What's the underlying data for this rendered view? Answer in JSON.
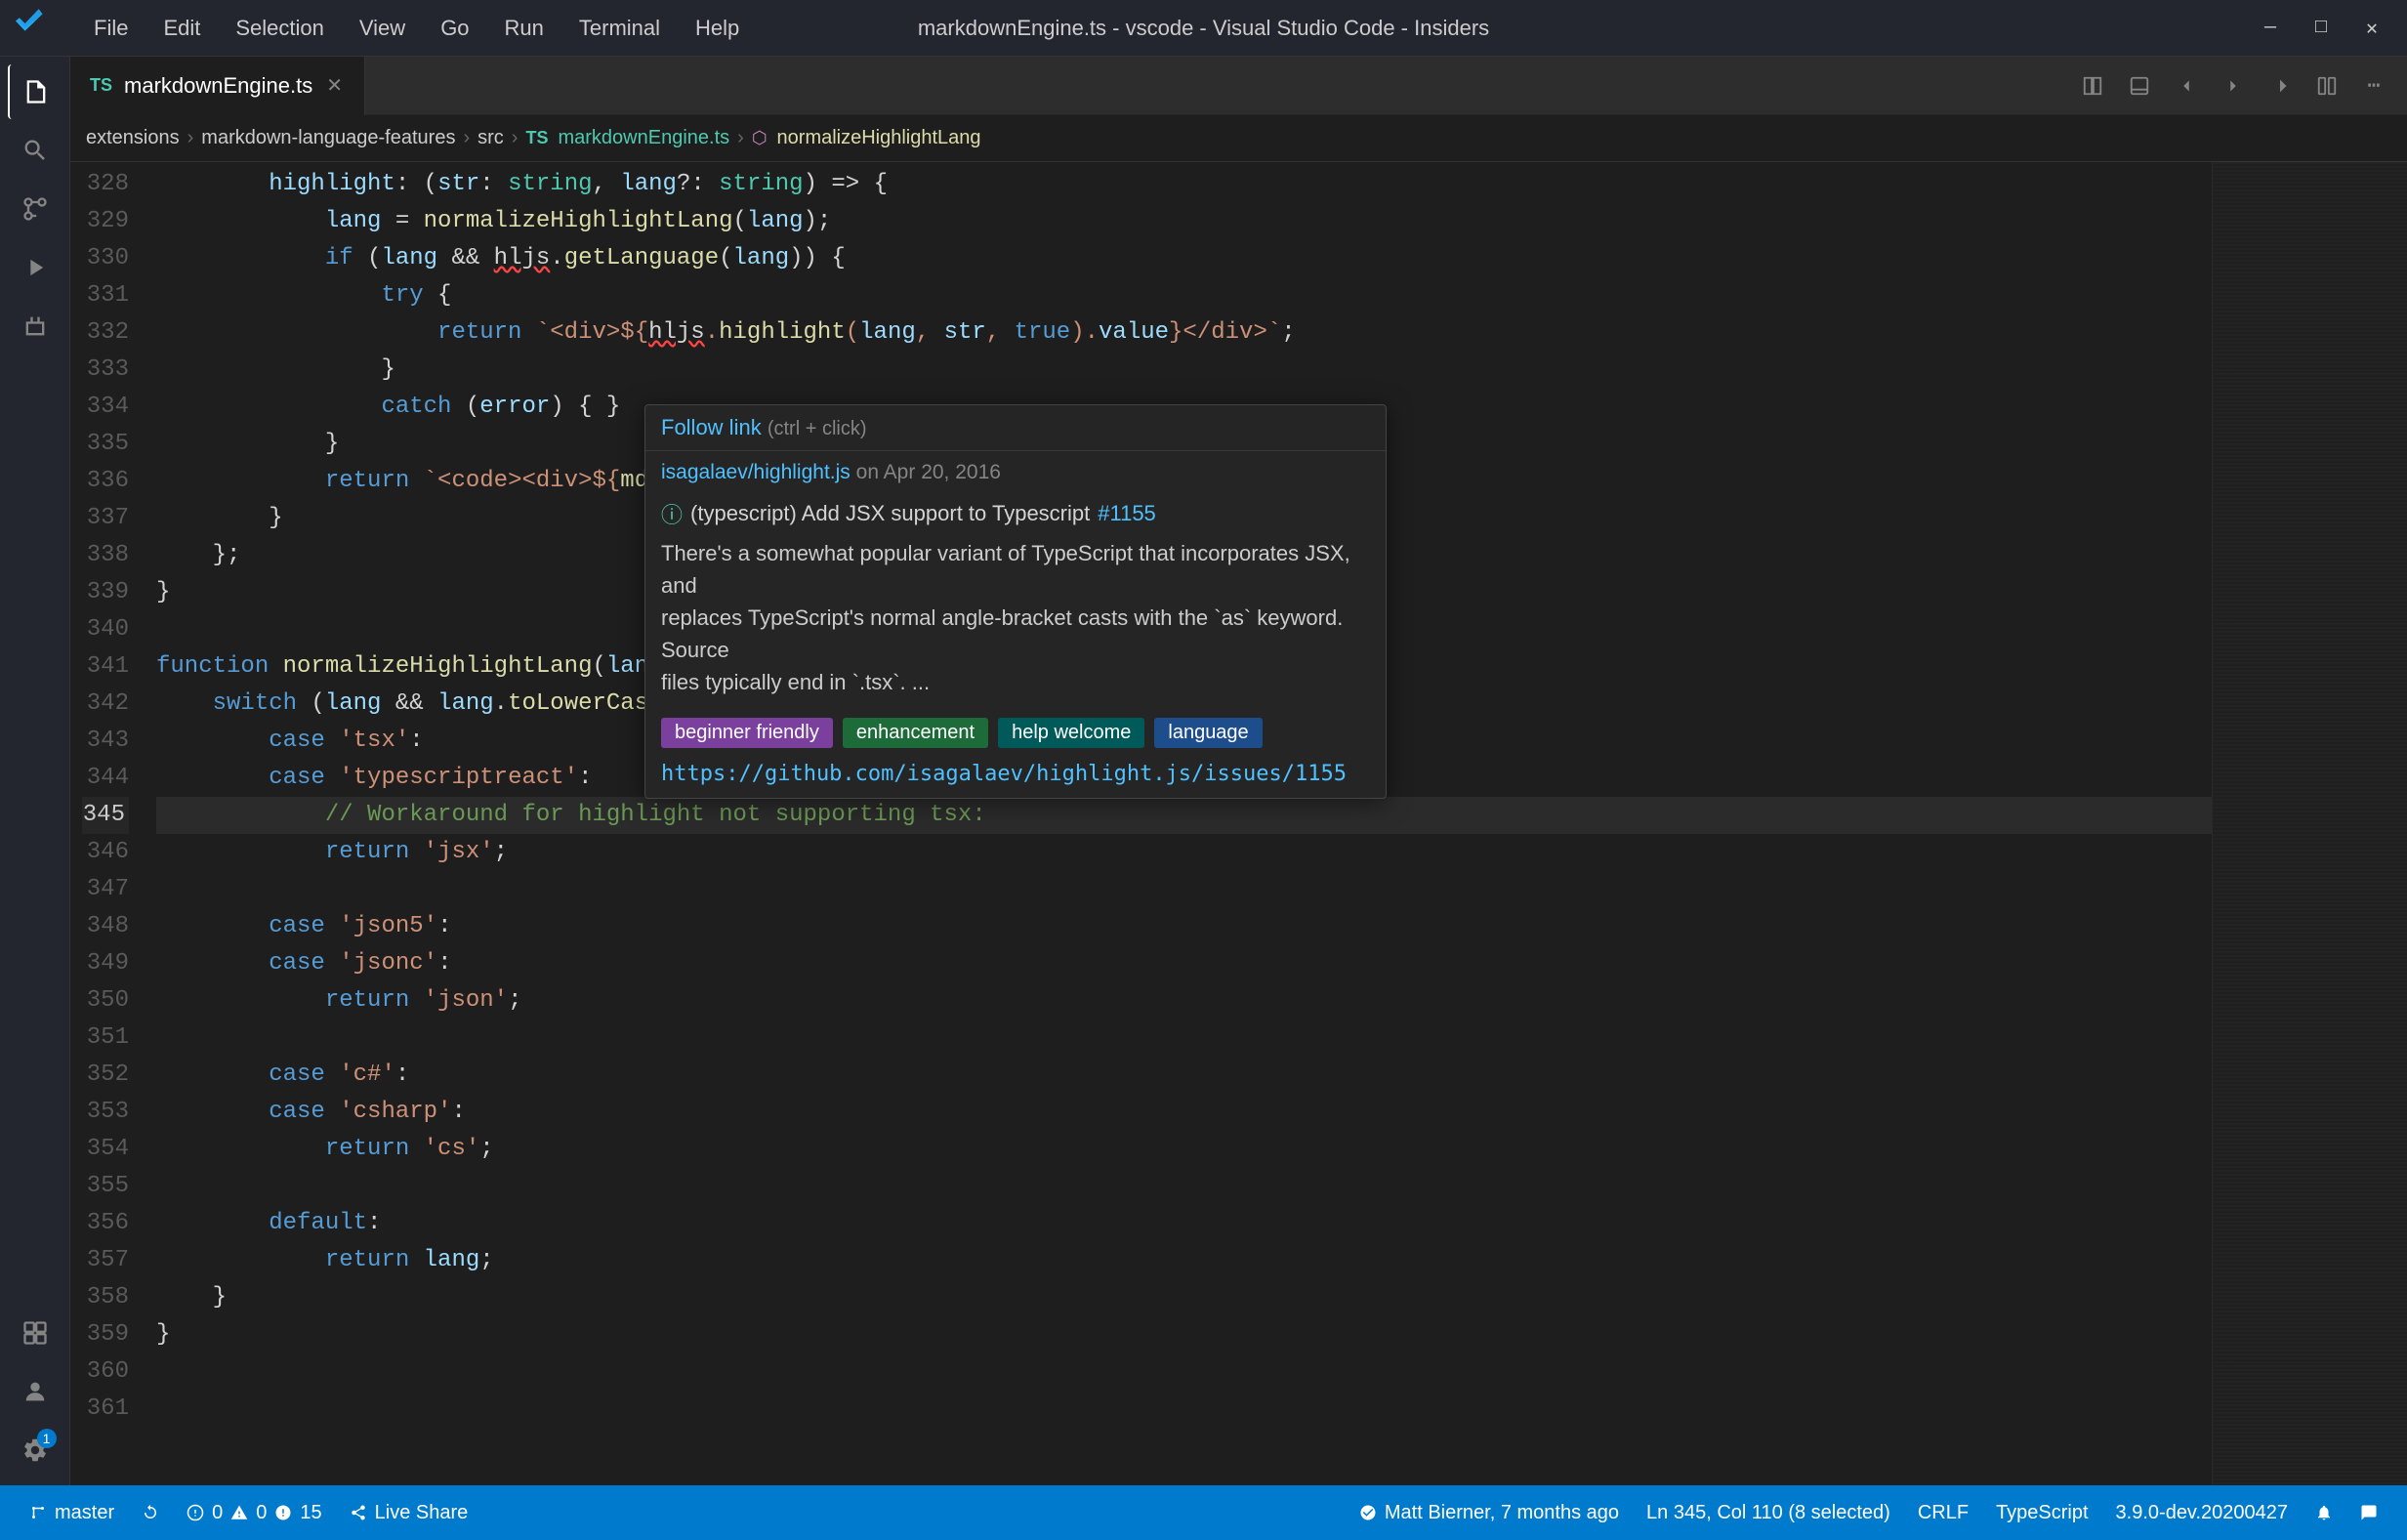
{
  "titleBar": {
    "title": "markdownEngine.ts - vscode - Visual Studio Code - Insiders",
    "menus": [
      "File",
      "Edit",
      "Selection",
      "View",
      "Go",
      "Run",
      "Terminal",
      "Help"
    ]
  },
  "tabs": [
    {
      "label": "markdownEngine.ts",
      "type": "TS",
      "active": true
    }
  ],
  "breadcrumb": {
    "items": [
      "extensions",
      "markdown-language-features",
      "src",
      "markdownEngine.ts",
      "normalizeHighlightLang"
    ]
  },
  "codeLines": [
    {
      "num": "328",
      "content": "        highlight: (str: string, lang?: string) => {"
    },
    {
      "num": "329",
      "content": "            lang = normalizeHighlightLang(lang);"
    },
    {
      "num": "330",
      "content": "            if (lang && hljs.getLanguage(lang)) {"
    },
    {
      "num": "331",
      "content": "                try {"
    },
    {
      "num": "332",
      "content": "                    return `<div>${hljs.highlight(lang, str, true).value}</div>`;"
    },
    {
      "num": "333",
      "content": "                }"
    },
    {
      "num": "334",
      "content": "                catch (error) { }"
    },
    {
      "num": "335",
      "content": "            }"
    },
    {
      "num": "336",
      "content": "            return `<code><div>${md().utils.escapeHtml(str)"
    },
    {
      "num": "337",
      "content": "        }"
    },
    {
      "num": "338",
      "content": "    };"
    },
    {
      "num": "339",
      "content": "}"
    },
    {
      "num": "340",
      "content": ""
    },
    {
      "num": "341",
      "content": "function normalizeHighlightLang(lang: string | undefined) {"
    },
    {
      "num": "342",
      "content": "    switch (lang && lang.toLowerCase()) {"
    },
    {
      "num": "343",
      "content": "        case 'tsx':"
    },
    {
      "num": "344",
      "content": "        case 'typescriptreact':"
    },
    {
      "num": "345",
      "content": "            // Workaround for highlight not supporting tsx:"
    },
    {
      "num": "346",
      "content": "            return 'jsx';"
    },
    {
      "num": "347",
      "content": ""
    },
    {
      "num": "348",
      "content": "        case 'json5':"
    },
    {
      "num": "349",
      "content": "        case 'jsonc':"
    },
    {
      "num": "350",
      "content": "            return 'json';"
    },
    {
      "num": "351",
      "content": ""
    },
    {
      "num": "352",
      "content": "        case 'c#':"
    },
    {
      "num": "353",
      "content": "        case 'csharp':"
    },
    {
      "num": "354",
      "content": "            return 'cs';"
    },
    {
      "num": "355",
      "content": ""
    },
    {
      "num": "356",
      "content": "        default:"
    },
    {
      "num": "357",
      "content": "            return lang;"
    },
    {
      "num": "358",
      "content": "    }"
    },
    {
      "num": "359",
      "content": "}"
    },
    {
      "num": "360",
      "content": ""
    },
    {
      "num": "361",
      "content": ""
    }
  ],
  "hoverPopup": {
    "followLink": "Follow link",
    "shortcut": "(ctrl + click)",
    "commit": "isagalaev/highlight.js",
    "commitDate": "on Apr 20, 2016",
    "infoIcon": "ℹ",
    "titlePrefix": "(typescript) Add JSX support to Typescript",
    "issueNum": "#1155",
    "body": "There's a somewhat popular variant of TypeScript that incorporates JSX, and\nreplaces TypeScript's normal angle-bracket casts with the `as` keyword. Source\nfiles typically end in `.tsx`. ...",
    "tags": [
      {
        "label": "beginner friendly",
        "class": "tag-purple"
      },
      {
        "label": "enhancement",
        "class": "tag-green"
      },
      {
        "label": "help welcome",
        "class": "tag-teal"
      },
      {
        "label": "language",
        "class": "tag-blue"
      }
    ],
    "url": "https://github.com/isagalaev/highlight.js/issues/1155"
  },
  "statusBar": {
    "branch": "master",
    "sync": "",
    "errors": "0",
    "warnings": "0",
    "info": "15",
    "liveShare": "Live Share",
    "user": "Matt Bierner, 7 months ago",
    "position": "Ln 345, Col 110 (8 selected)",
    "lineEnding": "CRLF",
    "language": "TypeScript",
    "version": "3.9.0-dev.20200427",
    "bell": "",
    "notifications": ""
  },
  "activityBar": {
    "icons": [
      {
        "name": "explorer-icon",
        "symbol": "📄",
        "label": "Explorer",
        "active": true
      },
      {
        "name": "search-icon",
        "symbol": "🔍",
        "label": "Search"
      },
      {
        "name": "source-control-icon",
        "symbol": "⎇",
        "label": "Source Control"
      },
      {
        "name": "run-icon",
        "symbol": "▶",
        "label": "Run"
      },
      {
        "name": "extensions-icon",
        "symbol": "⧉",
        "label": "Extensions"
      }
    ],
    "bottomIcons": [
      {
        "name": "remote-icon",
        "symbol": "⊞",
        "label": "Remote"
      },
      {
        "name": "account-icon",
        "symbol": "👤",
        "label": "Account"
      },
      {
        "name": "settings-icon",
        "symbol": "⚙",
        "label": "Settings",
        "badge": "1"
      }
    ]
  }
}
